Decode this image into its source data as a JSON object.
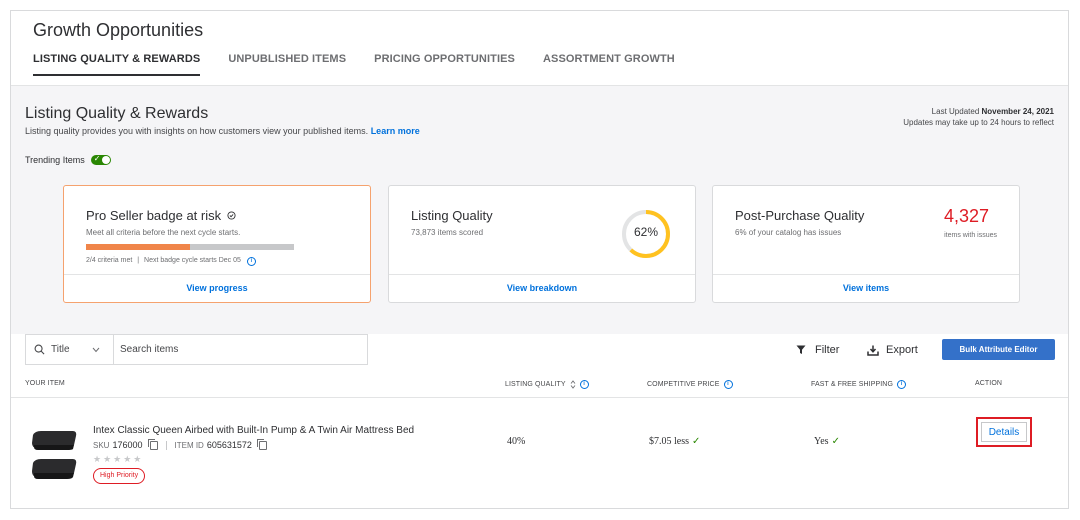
{
  "page": {
    "title": "Growth Opportunities"
  },
  "tabs": [
    {
      "label": "LISTING QUALITY & REWARDS",
      "active": true
    },
    {
      "label": "UNPUBLISHED ITEMS",
      "active": false
    },
    {
      "label": "PRICING OPPORTUNITIES",
      "active": false
    },
    {
      "label": "ASSORTMENT GROWTH",
      "active": false
    }
  ],
  "section": {
    "title": "Listing Quality & Rewards",
    "subtitle": "Listing quality provides you with insights on how customers view your published items.",
    "learn_more": "Learn more",
    "updated_prefix": "Last Updated",
    "updated_date": "November 24, 2021",
    "updated_note": "Updates may take up to 24 hours to reflect",
    "trending_label": "Trending Items",
    "trending_on": true
  },
  "cards": {
    "pro_seller": {
      "title": "Pro Seller badge at risk",
      "subtitle": "Meet all criteria before the next cycle starts.",
      "criteria_met": 2,
      "criteria_total": 4,
      "criteria_text": "2/4 criteria met",
      "next_cycle": "Next badge cycle starts Dec 05",
      "link": "View progress"
    },
    "listing_quality": {
      "title": "Listing Quality",
      "subtitle": "73,873 items scored",
      "percent": 62,
      "percent_label": "62%",
      "link": "View breakdown"
    },
    "post_purchase": {
      "title": "Post-Purchase Quality",
      "subtitle": "6% of your catalog has issues",
      "count": "4,327",
      "count_label": "items with issues",
      "link": "View items"
    }
  },
  "toolbar": {
    "search_field": "Title",
    "search_placeholder": "Search items",
    "filter_label": "Filter",
    "export_label": "Export",
    "bulk_label": "Bulk Attribute Editor"
  },
  "table": {
    "columns": {
      "item": "YOUR ITEM",
      "quality": "LISTING QUALITY",
      "price": "COMPETITIVE PRICE",
      "shipping": "FAST & FREE SHIPPING",
      "action": "ACTION"
    },
    "rows": [
      {
        "name": "Intex Classic Queen Airbed with Built-In Pump & A Twin Air Mattress Bed",
        "sku_label": "SKU",
        "sku": "176000",
        "item_id_label": "ITEM ID",
        "item_id": "605631572",
        "rating": 0,
        "priority": "High Priority",
        "quality": "40%",
        "price": "$7.05 less",
        "shipping": "Yes",
        "action": "Details"
      }
    ]
  },
  "colors": {
    "accent_blue": "#0071dc",
    "button_blue": "#3471c9",
    "alert_red": "#de1c24",
    "progress_orange": "#f0854a",
    "ring_yellow": "#ffc220",
    "success_green": "#2a8703"
  }
}
